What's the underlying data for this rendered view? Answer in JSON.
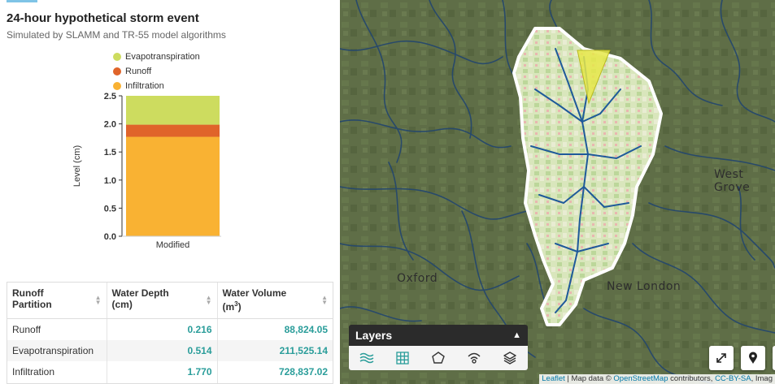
{
  "panel": {
    "title": "24-hour hypothetical storm event",
    "subtitle": "Simulated by SLAMM and TR-55 model algorithms"
  },
  "legend": [
    {
      "label": "Evapotranspiration",
      "color": "#cddc5f"
    },
    {
      "label": "Runoff",
      "color": "#e0642a"
    },
    {
      "label": "Infiltration",
      "color": "#f9b233"
    }
  ],
  "chart_data": {
    "type": "bar",
    "stacked": true,
    "categories": [
      "Modified"
    ],
    "series": [
      {
        "name": "Infiltration",
        "values": [
          1.77
        ],
        "color": "#f9b233"
      },
      {
        "name": "Runoff",
        "values": [
          0.216
        ],
        "color": "#e0642a"
      },
      {
        "name": "Evapotranspiration",
        "values": [
          0.514
        ],
        "color": "#cddc5f"
      }
    ],
    "ylabel": "Level (cm)",
    "ylim": [
      0,
      2.5
    ],
    "yticks": [
      "0.0",
      "0.5",
      "1.0",
      "1.5",
      "2.0",
      "2.5"
    ]
  },
  "table": {
    "headers": [
      {
        "line1": "Runoff",
        "line2": "Partition"
      },
      {
        "line1": "Water Depth",
        "line2": "(cm)"
      },
      {
        "line1": "Water Volume",
        "line2": "(m",
        "sup": "3",
        "line2_end": ")"
      }
    ],
    "rows": [
      [
        "Runoff",
        "0.216",
        "88,824.05"
      ],
      [
        "Evapotranspiration",
        "0.514",
        "211,525.14"
      ],
      [
        "Infiltration",
        "1.770",
        "728,837.02"
      ]
    ]
  },
  "map": {
    "places": [
      "West Grove",
      "Oxford",
      "New London"
    ],
    "layers_title": "Layers",
    "layer_icons": [
      "streams-icon",
      "grid-icon",
      "polygon-icon",
      "signal-icon",
      "stack-icon"
    ],
    "buttons": [
      "expand-icon",
      "marker-icon"
    ],
    "attribution": {
      "leaflet": "Leaflet",
      "sep": " | Map data © ",
      "osm": "OpenStreetMap",
      "mid": " contributors, ",
      "license": "CC-BY-SA",
      "tail": ", Imag"
    }
  }
}
